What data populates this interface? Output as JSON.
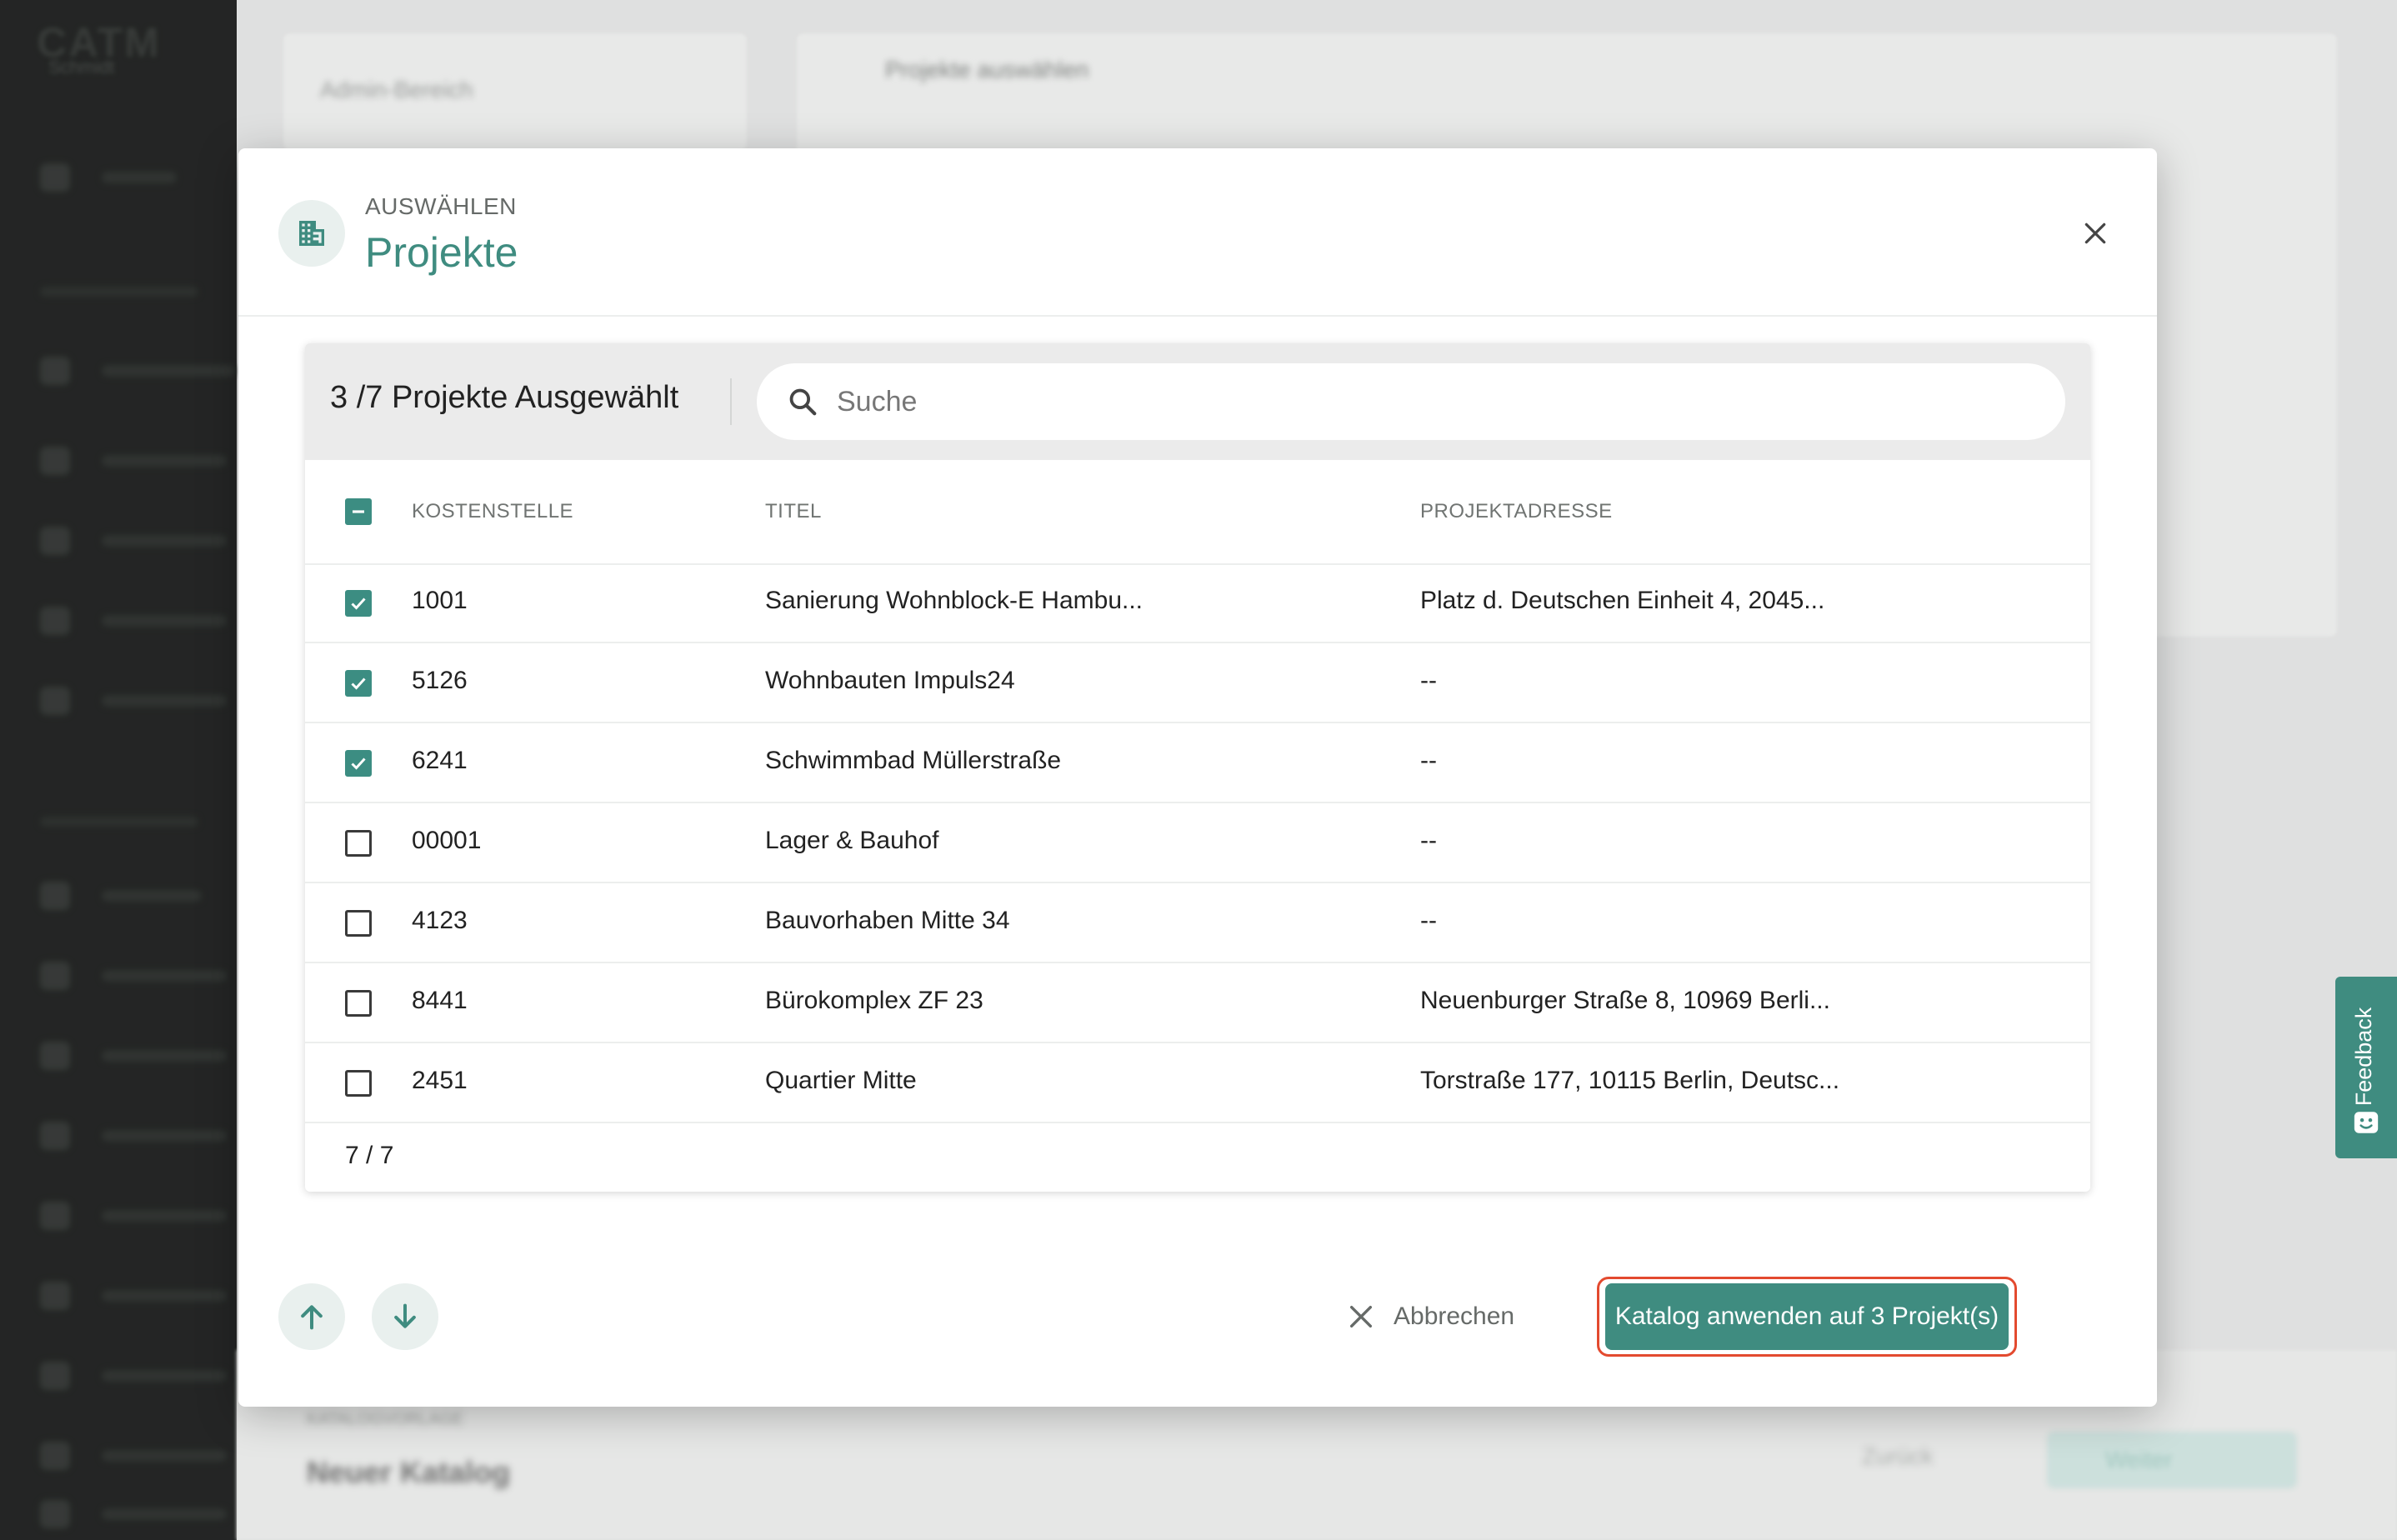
{
  "background": {
    "logo": "CATM",
    "logo_sub": "Schmidt",
    "admin_area": "Admin-Bereich",
    "panel_title": "Projekte auswählen",
    "bottom_section_label": "KATALOGVORLAGE",
    "bottom_title": "Neuer Katalog",
    "back_button": "Zurück",
    "next_button": "Weiter"
  },
  "modal": {
    "eyebrow": "AUSWÄHLEN",
    "title": "Projekte",
    "icon": "building-icon",
    "close_icon": "close-icon"
  },
  "toolbar": {
    "selection_count": "3 /7 Projekte Ausgewählt",
    "search_placeholder": "Suche",
    "search_value": ""
  },
  "table": {
    "header_checkbox_state": "indeterminate",
    "columns": [
      "KOSTENSTELLE",
      "TITEL",
      "PROJEKTADRESSE"
    ],
    "rows": [
      {
        "checked": true,
        "kostenstelle": "1001",
        "titel": "Sanierung Wohnblock-E Hambu...",
        "adresse": "Platz d. Deutschen Einheit 4, 2045..."
      },
      {
        "checked": true,
        "kostenstelle": "5126",
        "titel": "Wohnbauten Impuls24",
        "adresse": "--"
      },
      {
        "checked": true,
        "kostenstelle": "6241",
        "titel": "Schwimmbad Müllerstraße",
        "adresse": "--"
      },
      {
        "checked": false,
        "kostenstelle": "00001",
        "titel": "Lager & Bauhof",
        "adresse": "--"
      },
      {
        "checked": false,
        "kostenstelle": "4123",
        "titel": "Bauvorhaben Mitte 34",
        "adresse": "--"
      },
      {
        "checked": false,
        "kostenstelle": "8441",
        "titel": "Bürokomplex ZF 23",
        "adresse": "Neuenburger Straße 8, 10969 Berli..."
      },
      {
        "checked": false,
        "kostenstelle": "2451",
        "titel": "Quartier Mitte",
        "adresse": "Torstraße 177, 10115 Berlin, Deutsc..."
      }
    ],
    "footer_count": "7 / 7"
  },
  "footer": {
    "up_icon": "arrow-up-icon",
    "down_icon": "arrow-down-icon",
    "cancel_label": "Abbrechen",
    "apply_label": "Katalog anwenden auf 3 Projekt(s)"
  },
  "feedback_tab": {
    "label": "Feedback"
  },
  "colors": {
    "accent": "#3f8c80",
    "accent_light": "#e9f0ee",
    "highlight_outline": "#e34a2f",
    "sidebar": "#262827"
  }
}
